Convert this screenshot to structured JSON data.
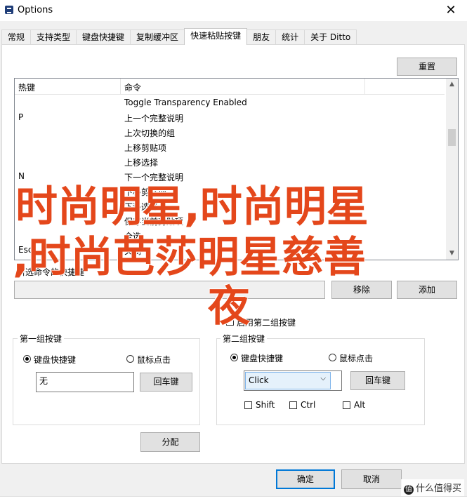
{
  "window": {
    "title": "Options",
    "close_glyph": "✕"
  },
  "tabs": [
    "常规",
    "支持类型",
    "键盘快捷键",
    "复制缓冲区",
    "快速粘贴按键",
    "朋友",
    "统计",
    "关于 Ditto"
  ],
  "buttons": {
    "reset": "重置",
    "remove": "移除",
    "add": "添加",
    "apply": "分配",
    "ok": "确定",
    "cancel": "取消"
  },
  "list": {
    "columns": [
      "热键",
      "命令"
    ],
    "rows": [
      {
        "key": "",
        "cmd": "Toggle Transparency Enabled"
      },
      {
        "key": "P",
        "cmd": "上一个完整说明"
      },
      {
        "key": "",
        "cmd": "上次切换的组"
      },
      {
        "key": "",
        "cmd": "上移剪贴项"
      },
      {
        "key": "",
        "cmd": "上移选择"
      },
      {
        "key": "N",
        "cmd": "下一个完整说明"
      },
      {
        "key": "",
        "cmd": "下移剪贴项"
      },
      {
        "key": "",
        "cmd": "下移选择"
      },
      {
        "key": "",
        "cmd": "保存当前剪贴项"
      },
      {
        "key": "",
        "cmd": "全选"
      },
      {
        "key": "Esc",
        "cmd": "关闭"
      }
    ]
  },
  "selected_label": "所选命令的快捷键",
  "enable_second": "启用第二组按键",
  "group1": {
    "title": "第一组按键",
    "radio_keyboard": "键盘快捷键",
    "radio_mouse": "鼠标点击",
    "value": "无",
    "enter": "回车键"
  },
  "group2": {
    "title": "第二组按键",
    "radio_keyboard": "键盘快捷键",
    "radio_mouse": "鼠标点击",
    "select_value": "Click",
    "enter": "回车键",
    "mods": [
      "Shift",
      "Ctrl",
      "Alt"
    ]
  },
  "overlay": {
    "line1": "时尚明星,时尚明星",
    "line2": ",时尚芭莎明星慈善",
    "line3": "夜"
  },
  "watermark": {
    "badge": "值",
    "text": "什么值得买"
  },
  "colors": {
    "overlay": "#e4471b",
    "accent": "#0078d7"
  }
}
